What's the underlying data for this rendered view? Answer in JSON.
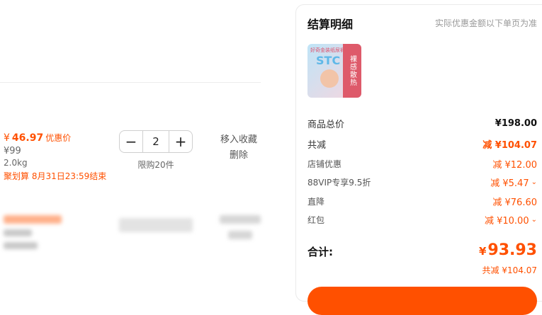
{
  "cart": {
    "item": {
      "currency": "¥",
      "price": "46.97",
      "price_tag": "优惠价",
      "original_price": "¥99",
      "weight": "2.0kg",
      "promo": "聚划算 8月31日23:59结束",
      "quantity": "2",
      "decrease_icon": "minus-icon",
      "increase_icon": "plus-icon",
      "limit": "限购20件",
      "move_to_favorites": "移入收藏",
      "delete": "删除"
    }
  },
  "summary": {
    "title": "结算明细",
    "note": "实际优惠金额以下单页为准",
    "product_image": {
      "side_text": "裸感散热",
      "ribbon_text": "好奇金装纸尿裤",
      "big_text": "STC"
    },
    "goods_total": {
      "label": "商品总价",
      "value": "¥198.00"
    },
    "total_discount": {
      "label": "共减",
      "value": "减 ¥104.07"
    },
    "store_discount": {
      "label": "店铺优惠",
      "value": "减 ¥12.00"
    },
    "vip_discount": {
      "label": "88VIP专享9.5折",
      "value": "减 ¥5.47"
    },
    "direct_discount": {
      "label": "直降",
      "value": "减 ¥76.60"
    },
    "red_packet": {
      "label": "红包",
      "value": "减 ¥10.00"
    },
    "total": {
      "label": "合计:",
      "currency": "¥",
      "amount": "93.93",
      "saved": "共减 ¥104.07"
    }
  },
  "colors": {
    "accent": "#ff5000",
    "text": "#333333",
    "muted": "#999999"
  }
}
